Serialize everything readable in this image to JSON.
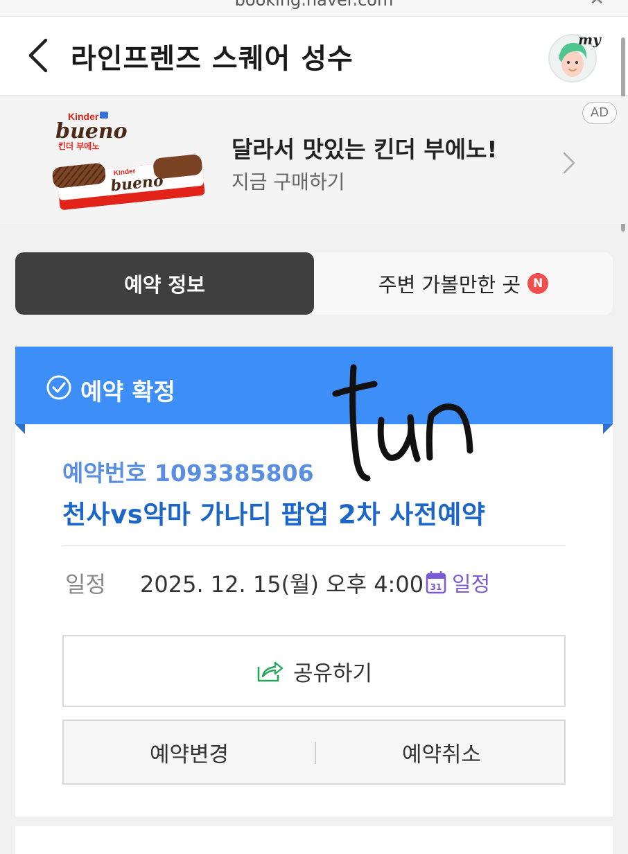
{
  "browser": {
    "url": "booking.naver.com"
  },
  "header": {
    "title": "라인프렌즈 스퀘어 성수",
    "avatar_label": "my"
  },
  "ad": {
    "brand_text": "bueno",
    "brand_small": "Kinder",
    "brand_korean": "킨더 부에노",
    "headline": "달라서 맛있는 킨더 부에노!",
    "subtext": "지금 구매하기",
    "badge": "AD"
  },
  "tabs": [
    {
      "label": "예약 정보",
      "active": true
    },
    {
      "label": "주변 가볼만한 곳",
      "active": false,
      "badge": "N"
    }
  ],
  "status": {
    "label": "예약 확정",
    "color": "#3e8ef7"
  },
  "booking": {
    "number_label": "예약번호",
    "number": "1093385806",
    "title": "천사vs악마 가나디 팝업 2차 사전예약",
    "date_label": "일정",
    "date_value": "2025. 12. 15(월) 오후 4:00",
    "calendar_day": "31",
    "calendar_link": "일정"
  },
  "actions": {
    "share": "공유하기",
    "change": "예약변경",
    "cancel": "예약취소"
  },
  "colors": {
    "primary_blue": "#3e8ef7",
    "title_blue": "#1c66c8",
    "calendar_purple": "#7b5ad6",
    "share_green": "#23a55a",
    "new_badge_red": "#f04d4d"
  },
  "handwriting": "tun"
}
